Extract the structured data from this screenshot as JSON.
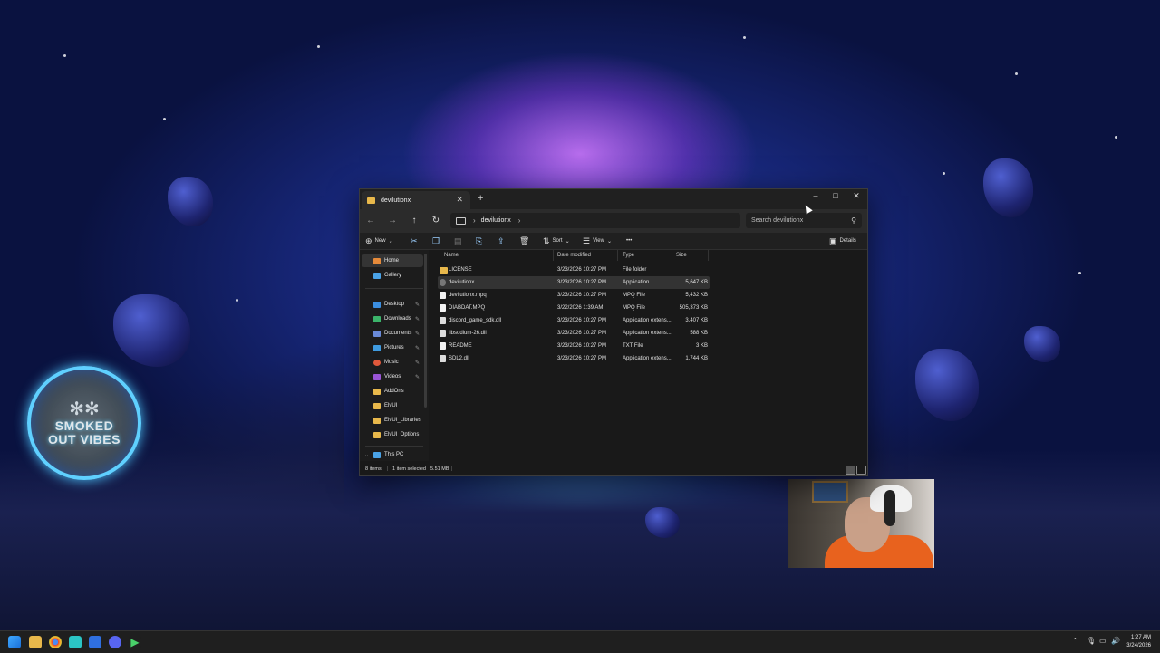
{
  "window": {
    "tab_title": "devilutionx",
    "address_segment": "devilutionx",
    "search_placeholder": "Search devilutionx"
  },
  "toolbar": {
    "new_label": "New",
    "sort_label": "Sort",
    "view_label": "View",
    "more_label": "•••",
    "details_label": "Details"
  },
  "nav": {
    "items": [
      {
        "label": "Home",
        "active": true,
        "color": "#e58a3a"
      },
      {
        "label": "Gallery",
        "color": "#4aa3e8"
      },
      {
        "label": "Desktop",
        "pinned": true,
        "color": "#3b8ee0"
      },
      {
        "label": "Downloads",
        "pinned": true,
        "color": "#3bb36a"
      },
      {
        "label": "Documents",
        "pinned": true,
        "color": "#6a8ad8"
      },
      {
        "label": "Pictures",
        "pinned": true,
        "color": "#3f9be0"
      },
      {
        "label": "Music",
        "pinned": true,
        "color": "#e0583b"
      },
      {
        "label": "Videos",
        "pinned": true,
        "color": "#9a55d6"
      },
      {
        "label": "AddOns",
        "color": "#e8b84b"
      },
      {
        "label": "ElvUI",
        "color": "#e8b84b"
      },
      {
        "label": "ElvUI_Libraries",
        "color": "#e8b84b"
      },
      {
        "label": "ElvUI_Options",
        "color": "#e8b84b"
      },
      {
        "label": "This PC",
        "color": "#4aa3e8"
      }
    ]
  },
  "columns": {
    "name": "Name",
    "date": "Date modified",
    "type": "Type",
    "size": "Size"
  },
  "files": [
    {
      "name": "LICENSE",
      "date": "3/23/2026 10:27 PM",
      "type": "File folder",
      "size": "",
      "icon": "folder-icon"
    },
    {
      "name": "devilutionx",
      "date": "3/23/2026 10:27 PM",
      "type": "Application",
      "size": "5,647 KB",
      "icon": "app-icon",
      "selected": true
    },
    {
      "name": "devilutionx.mpq",
      "date": "3/23/2026 10:27 PM",
      "type": "MPQ File",
      "size": "5,432 KB",
      "icon": "file-icon"
    },
    {
      "name": "DIABDAT.MPQ",
      "date": "3/22/2026 1:39 AM",
      "type": "MPQ File",
      "size": "505,373 KB",
      "icon": "file-icon"
    },
    {
      "name": "discord_game_sdk.dll",
      "date": "3/23/2026 10:27 PM",
      "type": "Application extens...",
      "size": "3,407 KB",
      "icon": "dll-icon"
    },
    {
      "name": "libsodium-26.dll",
      "date": "3/23/2026 10:27 PM",
      "type": "Application extens...",
      "size": "588 KB",
      "icon": "dll-icon"
    },
    {
      "name": "README",
      "date": "3/23/2026 10:27 PM",
      "type": "TXT File",
      "size": "3 KB",
      "icon": "file-icon"
    },
    {
      "name": "SDL2.dll",
      "date": "3/23/2026 10:27 PM",
      "type": "Application extens...",
      "size": "1,744 KB",
      "icon": "dll-icon"
    }
  ],
  "status": {
    "items": "8 items",
    "selected": "1 item selected",
    "selected_size": "5.51 MB"
  },
  "badge": {
    "line1": "SMOKED",
    "line2": "OUT VIBES"
  },
  "taskbar": {
    "time": "1:27 AM",
    "date": "3/24/2026"
  }
}
